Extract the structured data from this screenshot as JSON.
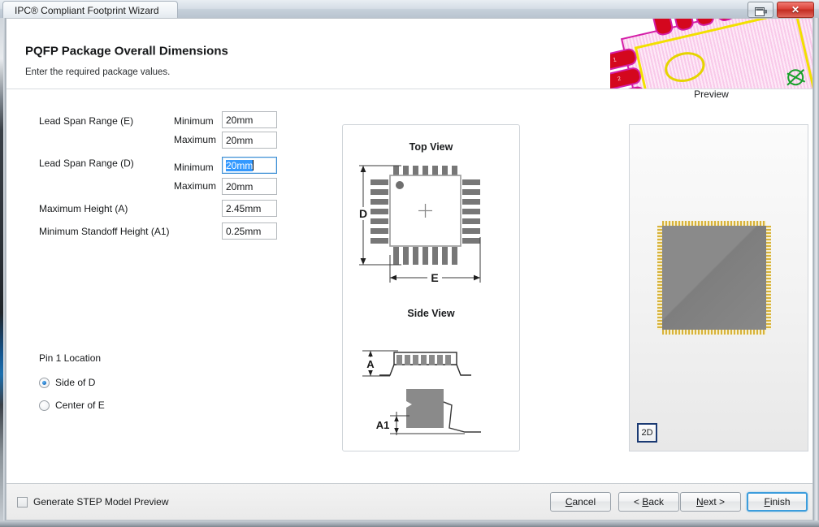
{
  "window": {
    "title": "IPC® Compliant Footprint Wizard",
    "restore_icon": "restore-window-icon",
    "close_icon": "close-window-icon",
    "close_glyph": "✕"
  },
  "header": {
    "title": "PQFP Package Overall Dimensions",
    "subtitle": "Enter the required package values.",
    "preview_label": "Preview"
  },
  "form": {
    "fields": [
      {
        "label": "Lead Span Range (E)",
        "sub": "Minimum",
        "value": "20mm",
        "focused": false
      },
      {
        "label": "",
        "sub": "Maximum",
        "value": "20mm",
        "focused": false
      },
      {
        "label": "Lead Span Range (D)",
        "sub": "Minimum",
        "value": "20mm",
        "focused": true
      },
      {
        "label": "",
        "sub": "Maximum",
        "value": "20mm",
        "focused": false
      },
      {
        "label": "Maximum Height (A)",
        "sub": "",
        "value": "2.45mm",
        "focused": false
      },
      {
        "label": "Minimum Standoff Height (A1)",
        "sub": "",
        "value": "0.25mm",
        "focused": false
      }
    ]
  },
  "pin1": {
    "title": "Pin 1 Location",
    "options": [
      {
        "label": "Side of D",
        "selected": true
      },
      {
        "label": "Center of E",
        "selected": false
      }
    ]
  },
  "diagram": {
    "top_view_title": "Top View",
    "side_view_title": "Side View",
    "dim_d": "D",
    "dim_e": "E",
    "dim_a": "A",
    "dim_a1": "A1",
    "leads_per_side": 7
  },
  "preview3d": {
    "view_mode_label": "2D",
    "body_color": "#8a8a8a",
    "lead_color": "#d8b23a"
  },
  "footer": {
    "checkbox_label": "Generate STEP Model Preview",
    "checkbox_checked": false,
    "buttons": [
      {
        "label_pre": "",
        "mnemonic": "C",
        "label_post": "ancel",
        "default": false
      },
      {
        "label_pre": "< ",
        "mnemonic": "B",
        "label_post": "ack",
        "default": false
      },
      {
        "label_pre": "",
        "mnemonic": "N",
        "label_post": "ext >",
        "default": false
      },
      {
        "label_pre": "",
        "mnemonic": "F",
        "label_post": "inish",
        "default": true
      }
    ]
  },
  "colors": {
    "accent_blue": "#3399ff",
    "focus_border": "#3c8fd4",
    "pad_red": "#d4071e",
    "silk_yellow": "#f2e000",
    "courtyard_green": "#3fb34a",
    "body_pink": "#fbd9f0"
  }
}
